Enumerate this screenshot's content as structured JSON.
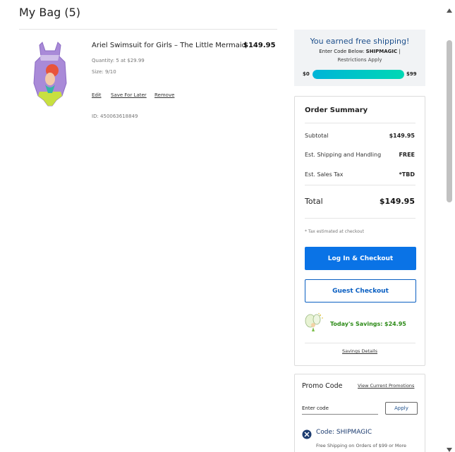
{
  "bag": {
    "title": "My Bag (5)"
  },
  "product": {
    "name": "Ariel Swimsuit for Girls – The Little Mermaid",
    "price": "$149.95",
    "quantity": "Quantity: 5 at $29.99",
    "size": "Size: 9/10",
    "id": "ID: 450063618849",
    "actions": {
      "edit": "Edit",
      "save_for_later": "Save For Later",
      "remove": "Remove"
    }
  },
  "shipping": {
    "title": "You earned free shipping!",
    "code_prefix": "Enter Code Below: ",
    "code": "SHIPMAGIC",
    "code_suffix": " |",
    "restrictions": "Restrictions Apply",
    "min_label": "$0",
    "max_label": "$99",
    "progress_fraction": 1.0
  },
  "summary": {
    "title": "Order Summary",
    "rows": [
      {
        "label": "Subtotal",
        "value": "$149.95"
      },
      {
        "label": "Est. Shipping and Handling",
        "value": "FREE"
      },
      {
        "label": "Est. Sales Tax",
        "value": "*TBD"
      }
    ],
    "total_label": "Total",
    "total_value": "$149.95",
    "tax_note": "* Tax estimated at checkout",
    "login_checkout": "Log In & Checkout",
    "guest_checkout": "Guest Checkout",
    "savings_label": "Today's Savings:",
    "savings_value": "$24.95",
    "savings_details": "Savings Details"
  },
  "promo": {
    "title": "Promo Code",
    "view_link": "View Current Promotions",
    "input_placeholder": "Enter code",
    "apply_label": "Apply",
    "applied_code": "Code: SHIPMAGIC",
    "applied_desc": "Free Shipping on Orders of $99 or More"
  },
  "colors": {
    "accent_blue": "#0a73e6",
    "savings_green": "#2b8a16",
    "banner_bg": "#f1f3f5",
    "progress_start": "#00b4d8",
    "progress_end": "#00d8b4"
  },
  "icons": {
    "product": "swimsuit-product-image",
    "savings": "tinker-bell-icon",
    "remove_promo": "close-circle-icon"
  }
}
